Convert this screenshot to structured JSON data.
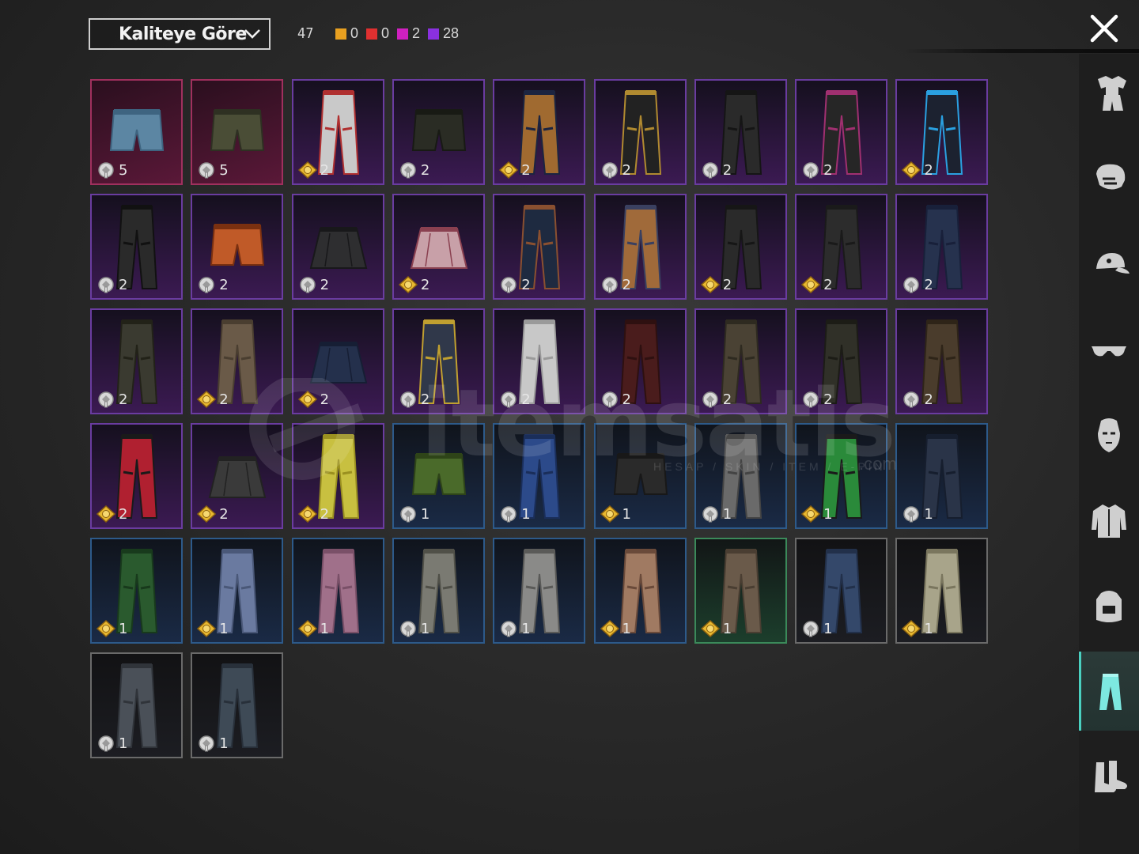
{
  "header": {
    "sort_label": "Kaliteye Göre",
    "total_count": "47",
    "rarity_counts": [
      {
        "color": "#e8a020",
        "value": "0"
      },
      {
        "color": "#e03030",
        "value": "0"
      },
      {
        "color": "#d020c0",
        "value": "2"
      },
      {
        "color": "#8a30e0",
        "value": "28"
      }
    ]
  },
  "watermark": {
    "text": "itemsatis",
    "subtitle": "HESAP / SKIN / ITEM / E-PIN",
    "suffix": ".com"
  },
  "items": [
    {
      "rarity": "legendary",
      "art": "shorts-denim",
      "currency": "silver",
      "count": "5"
    },
    {
      "rarity": "legendary",
      "art": "shorts-camo",
      "currency": "silver",
      "count": "5"
    },
    {
      "rarity": "epic",
      "art": "pants-white-red",
      "currency": "gold",
      "count": "2"
    },
    {
      "rarity": "epic",
      "art": "shorts-boots-black",
      "currency": "silver",
      "count": "2"
    },
    {
      "rarity": "epic",
      "art": "pants-gold",
      "currency": "gold",
      "count": "2"
    },
    {
      "rarity": "epic",
      "art": "pants-black-gold",
      "currency": "silver",
      "count": "2"
    },
    {
      "rarity": "epic",
      "art": "pants-black-straps",
      "currency": "silver",
      "count": "2"
    },
    {
      "rarity": "epic",
      "art": "pants-black-pink",
      "currency": "silver",
      "count": "2"
    },
    {
      "rarity": "epic",
      "art": "pants-black-blue",
      "currency": "gold",
      "count": "2"
    },
    {
      "rarity": "epic",
      "art": "pants-black-holster",
      "currency": "silver",
      "count": "2"
    },
    {
      "rarity": "epic",
      "art": "swim-orange",
      "currency": "silver",
      "count": "2"
    },
    {
      "rarity": "epic",
      "art": "skirt-black",
      "currency": "silver",
      "count": "2"
    },
    {
      "rarity": "epic",
      "art": "skirt-plaid",
      "currency": "gold",
      "count": "2"
    },
    {
      "rarity": "epic",
      "art": "pants-navy-brown",
      "currency": "silver",
      "count": "2"
    },
    {
      "rarity": "epic",
      "art": "pants-brown-chaps",
      "currency": "silver",
      "count": "2"
    },
    {
      "rarity": "epic",
      "art": "pants-black",
      "currency": "gold",
      "count": "2"
    },
    {
      "rarity": "epic",
      "art": "pants-leather",
      "currency": "gold",
      "count": "2"
    },
    {
      "rarity": "epic",
      "art": "jeans-navy",
      "currency": "silver",
      "count": "2"
    },
    {
      "rarity": "epic",
      "art": "pants-olive",
      "currency": "silver",
      "count": "2"
    },
    {
      "rarity": "epic",
      "art": "pants-brown-slim",
      "currency": "gold",
      "count": "2"
    },
    {
      "rarity": "epic",
      "art": "skirt-navy",
      "currency": "gold",
      "count": "2"
    },
    {
      "rarity": "epic",
      "art": "pants-camo-yellow",
      "currency": "silver",
      "count": "2"
    },
    {
      "rarity": "epic",
      "art": "pants-white",
      "currency": "silver",
      "count": "2"
    },
    {
      "rarity": "epic",
      "art": "pants-maroon",
      "currency": "silver",
      "count": "2"
    },
    {
      "rarity": "epic",
      "art": "pants-brown-cargo",
      "currency": "silver",
      "count": "2"
    },
    {
      "rarity": "epic",
      "art": "pants-dark-cargo",
      "currency": "silver",
      "count": "2"
    },
    {
      "rarity": "epic",
      "art": "pants-brown-baggy",
      "currency": "silver",
      "count": "2"
    },
    {
      "rarity": "epic",
      "art": "track-red",
      "currency": "gold",
      "count": "2"
    },
    {
      "rarity": "epic",
      "art": "skirt-pleated",
      "currency": "gold",
      "count": "2"
    },
    {
      "rarity": "epic",
      "art": "track-yellow",
      "currency": "gold",
      "count": "2"
    },
    {
      "rarity": "rare",
      "art": "shorts-green",
      "currency": "silver",
      "count": "1"
    },
    {
      "rarity": "rare",
      "art": "pants-blue",
      "currency": "silver",
      "count": "1"
    },
    {
      "rarity": "rare",
      "art": "shorts-black",
      "currency": "gold",
      "count": "1"
    },
    {
      "rarity": "rare",
      "art": "pants-grey",
      "currency": "silver",
      "count": "1"
    },
    {
      "rarity": "rare",
      "art": "track-green",
      "currency": "gold",
      "count": "1"
    },
    {
      "rarity": "rare",
      "art": "jeans-dark",
      "currency": "silver",
      "count": "1"
    },
    {
      "rarity": "rare",
      "art": "pants-green",
      "currency": "gold",
      "count": "1"
    },
    {
      "rarity": "rare",
      "art": "pants-lightblue",
      "currency": "gold",
      "count": "1"
    },
    {
      "rarity": "rare",
      "art": "pants-pink",
      "currency": "gold",
      "count": "1"
    },
    {
      "rarity": "rare",
      "art": "cargo-grey",
      "currency": "silver",
      "count": "1"
    },
    {
      "rarity": "rare",
      "art": "cargo-lightgrey",
      "currency": "silver",
      "count": "1"
    },
    {
      "rarity": "rare",
      "art": "pants-tan-straps",
      "currency": "gold",
      "count": "1"
    },
    {
      "rarity": "uncommon",
      "art": "cargo-brown",
      "currency": "gold",
      "count": "1"
    },
    {
      "rarity": "common",
      "art": "jeans-blue",
      "currency": "silver",
      "count": "1"
    },
    {
      "rarity": "common",
      "art": "cargo-khaki",
      "currency": "gold",
      "count": "1"
    },
    {
      "rarity": "common",
      "art": "jeans-grey",
      "currency": "silver",
      "count": "1"
    },
    {
      "rarity": "common",
      "art": "jeans-slate",
      "currency": "silver",
      "count": "1"
    }
  ],
  "sidebar": {
    "tabs": [
      {
        "icon": "outfit-icon",
        "active": false
      },
      {
        "icon": "mask-icon",
        "active": false
      },
      {
        "icon": "cap-icon",
        "active": false
      },
      {
        "icon": "glasses-icon",
        "active": false
      },
      {
        "icon": "face-icon",
        "active": false
      },
      {
        "icon": "jacket-icon",
        "active": false
      },
      {
        "icon": "backpack-icon",
        "active": false
      },
      {
        "icon": "pants-icon",
        "active": true
      },
      {
        "icon": "shoes-icon",
        "active": false
      }
    ]
  }
}
